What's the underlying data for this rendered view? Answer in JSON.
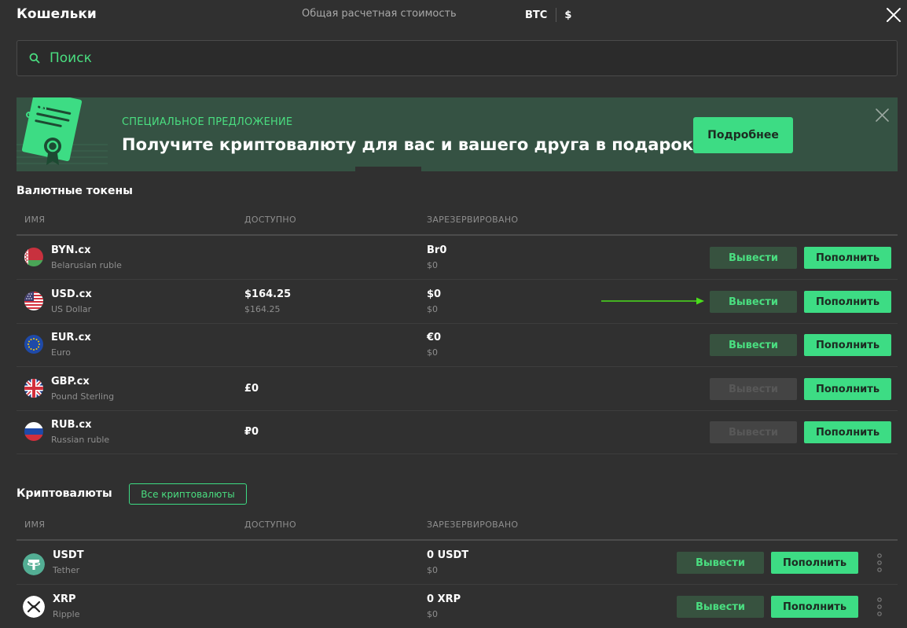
{
  "header": {
    "title": "Кошельки",
    "total_label": "Общая расчетная стоимость",
    "currency_btc": "BTC",
    "currency_usd": "$"
  },
  "search": {
    "placeholder": "Поиск"
  },
  "banner": {
    "kicker": "СПЕЦИАЛЬНОЕ ПРЕДЛОЖЕНИЕ",
    "headline": "Получите криптовалюту для вас и вашего друга в подарок",
    "button": "Подробнее"
  },
  "tokens": {
    "title": "Валютные токены",
    "col_name": "ИМЯ",
    "col_available": "ДОСТУПНО",
    "col_reserved": "ЗАРЕЗЕРВИРОВАНО",
    "rows": [
      {
        "code": "BYN.cx",
        "name": "Belarusian ruble",
        "available": "",
        "available_sub": "",
        "reserved": "Br0",
        "reserved_sub": "$0",
        "withdraw": "Вывести",
        "deposit": "Пополнить",
        "withdraw_enabled": true
      },
      {
        "code": "USD.cx",
        "name": "US Dollar",
        "available": "$164.25",
        "available_sub": "$164.25",
        "reserved": "$0",
        "reserved_sub": "$0",
        "withdraw": "Вывести",
        "deposit": "Пополнить",
        "withdraw_enabled": true
      },
      {
        "code": "EUR.cx",
        "name": "Euro",
        "available": "",
        "available_sub": "",
        "reserved": "€0",
        "reserved_sub": "$0",
        "withdraw": "Вывести",
        "deposit": "Пополнить",
        "withdraw_enabled": true
      },
      {
        "code": "GBP.cx",
        "name": "Pound Sterling",
        "available": "£0",
        "available_sub": "",
        "reserved": "",
        "reserved_sub": "",
        "withdraw": "Вывести",
        "deposit": "Пополнить",
        "withdraw_enabled": false
      },
      {
        "code": "RUB.cx",
        "name": "Russian ruble",
        "available": "₽0",
        "available_sub": "",
        "reserved": "",
        "reserved_sub": "",
        "withdraw": "Вывести",
        "deposit": "Пополнить",
        "withdraw_enabled": false
      }
    ]
  },
  "crypto": {
    "title": "Криптовалюты",
    "all_button": "Все криптовалюты",
    "col_name": "ИМЯ",
    "col_available": "ДОСТУПНО",
    "col_reserved": "ЗАРЕЗЕРВИРОВАНО",
    "rows": [
      {
        "code": "USDT",
        "name": "Tether",
        "reserved": "0 USDT",
        "reserved_sub": "$0",
        "withdraw": "Вывести",
        "deposit": "Пополнить"
      },
      {
        "code": "XRP",
        "name": "Ripple",
        "reserved": "0 XRP",
        "reserved_sub": "$0",
        "withdraw": "Вывести",
        "deposit": "Пополнить"
      }
    ]
  },
  "colors": {
    "accent": "#3ddc84",
    "background": "#303030",
    "banner": "#355243"
  }
}
